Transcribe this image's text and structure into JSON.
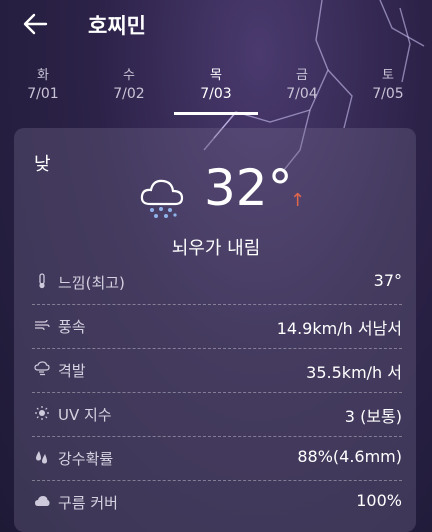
{
  "header": {
    "title": "호찌민"
  },
  "tabs": [
    {
      "dow": "화",
      "date": "7/01"
    },
    {
      "dow": "수",
      "date": "7/02"
    },
    {
      "dow": "목",
      "date": "7/03"
    },
    {
      "dow": "금",
      "date": "7/04"
    },
    {
      "dow": "토",
      "date": "7/05"
    }
  ],
  "selected_tab": "목",
  "forecast": {
    "period": "낮",
    "temperature": "32°",
    "trend_symbol": "↑",
    "condition": "뇌우가 내림",
    "icon": "thunderstorm-cloud-icon"
  },
  "details": [
    {
      "icon": "thermometer-icon",
      "label": "느낌(최고)",
      "value": "37°"
    },
    {
      "icon": "wind-icon",
      "label": "풍속",
      "value": "14.9km/h 서남서"
    },
    {
      "icon": "gust-icon",
      "label": "격발",
      "value": "35.5km/h 서"
    },
    {
      "icon": "sun-icon",
      "label": "UV 지수",
      "value": "3 (보통)"
    },
    {
      "icon": "raindrops-icon",
      "label": "강수확률",
      "value": "88%(4.6mm)"
    },
    {
      "icon": "cloud-icon",
      "label": "구름 커버",
      "value": "100%"
    }
  ],
  "colors": {
    "trend_arrow": "#e2674a",
    "background": "#2c2248"
  }
}
